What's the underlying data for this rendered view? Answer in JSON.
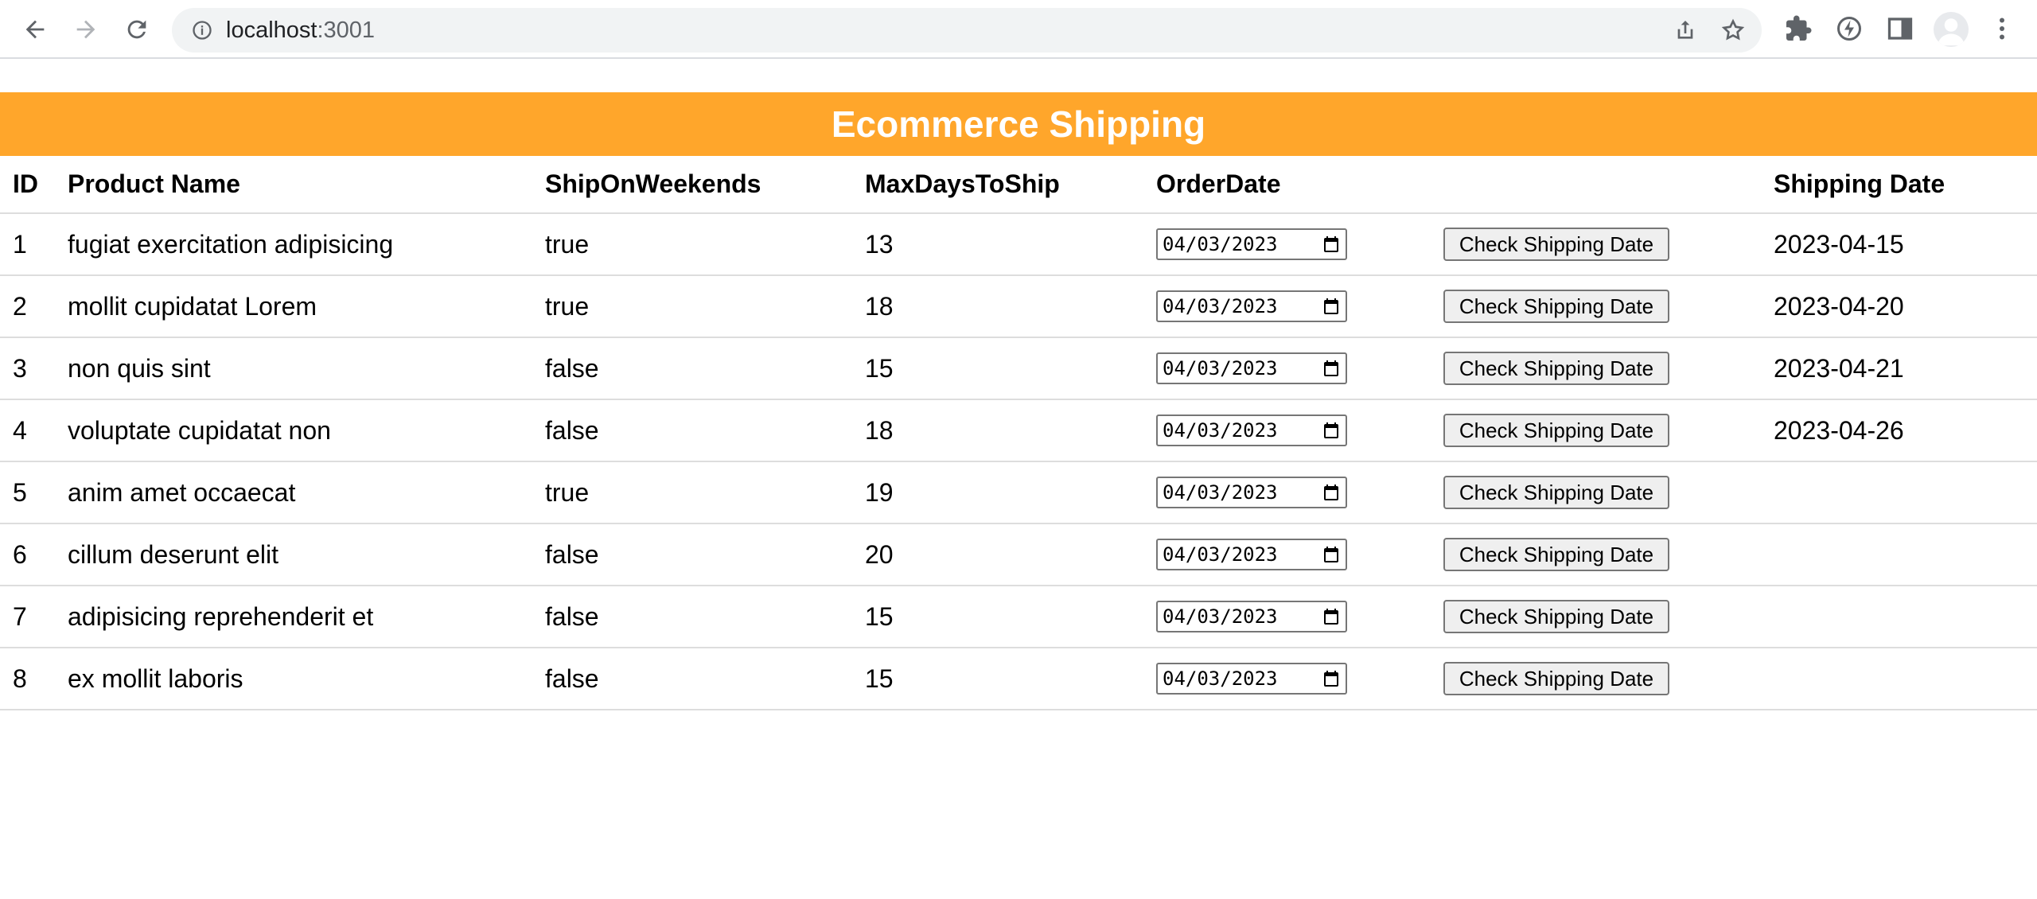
{
  "browser": {
    "url_host": "localhost",
    "url_port": ":3001"
  },
  "page": {
    "title": "Ecommerce Shipping",
    "headers": [
      "ID",
      "Product Name",
      "ShipOnWeekends",
      "MaxDaysToShip",
      "OrderDate",
      "",
      "Shipping Date"
    ],
    "button_label": "Check Shipping Date",
    "rows": [
      {
        "id": "1",
        "name": "fugiat exercitation adipisicing",
        "weekends": "true",
        "maxdays": "13",
        "order_date": "04/03/2023",
        "shipping_date": "2023-04-15"
      },
      {
        "id": "2",
        "name": "mollit cupidatat Lorem",
        "weekends": "true",
        "maxdays": "18",
        "order_date": "04/03/2023",
        "shipping_date": "2023-04-20"
      },
      {
        "id": "3",
        "name": "non quis sint",
        "weekends": "false",
        "maxdays": "15",
        "order_date": "04/03/2023",
        "shipping_date": "2023-04-21"
      },
      {
        "id": "4",
        "name": "voluptate cupidatat non",
        "weekends": "false",
        "maxdays": "18",
        "order_date": "04/03/2023",
        "shipping_date": "2023-04-26"
      },
      {
        "id": "5",
        "name": "anim amet occaecat",
        "weekends": "true",
        "maxdays": "19",
        "order_date": "04/03/2023",
        "shipping_date": ""
      },
      {
        "id": "6",
        "name": "cillum deserunt elit",
        "weekends": "false",
        "maxdays": "20",
        "order_date": "04/03/2023",
        "shipping_date": ""
      },
      {
        "id": "7",
        "name": "adipisicing reprehenderit et",
        "weekends": "false",
        "maxdays": "15",
        "order_date": "04/03/2023",
        "shipping_date": ""
      },
      {
        "id": "8",
        "name": "ex mollit laboris",
        "weekends": "false",
        "maxdays": "15",
        "order_date": "04/03/2023",
        "shipping_date": ""
      }
    ]
  },
  "colors": {
    "banner": "#ffa62b",
    "banner_text": "#ffffff"
  }
}
